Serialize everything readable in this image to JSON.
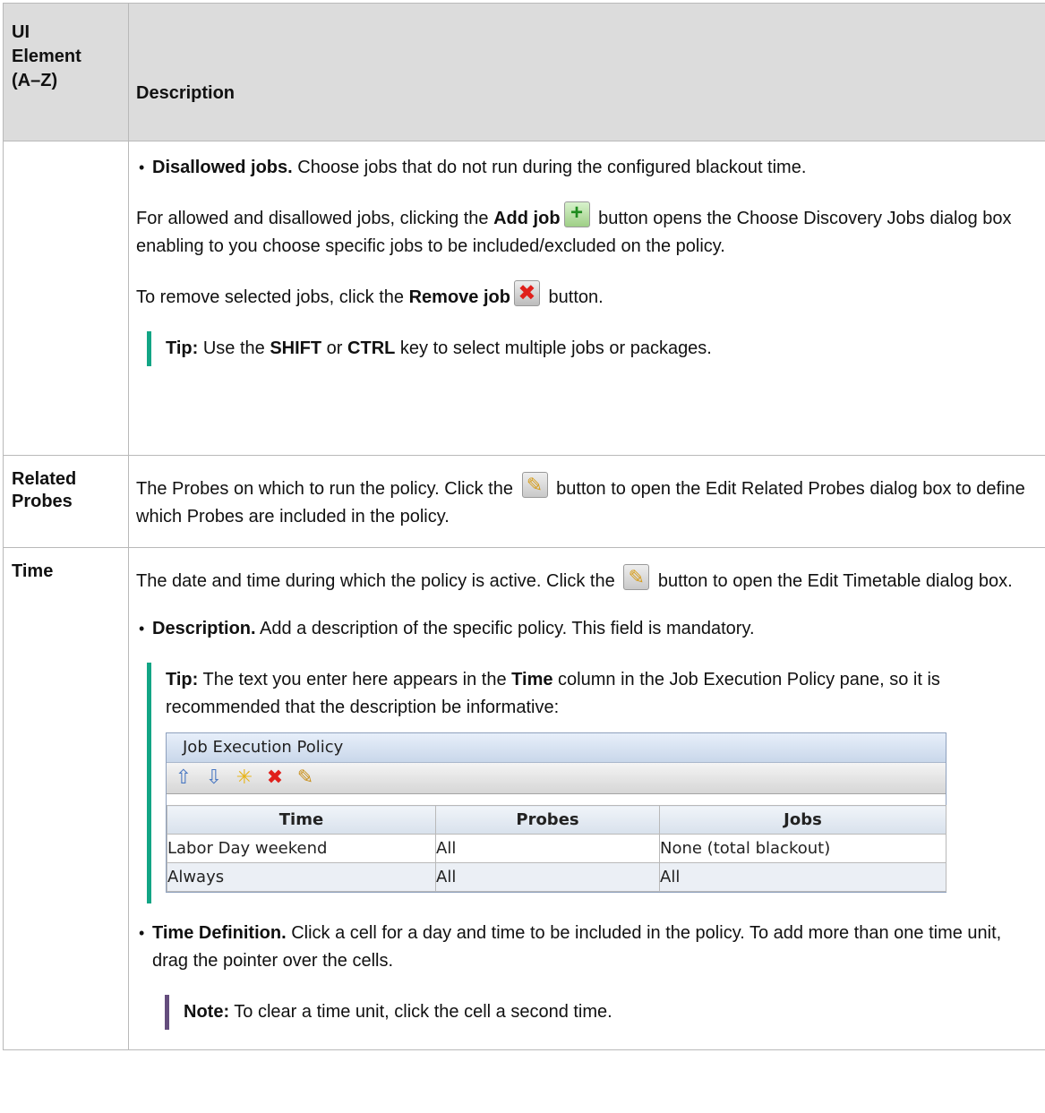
{
  "header": {
    "col1": [
      "UI",
      "Element",
      "(A–Z)"
    ],
    "col2": "Description"
  },
  "row1": {
    "bullet_bold": "Disallowed jobs.",
    "bullet_text": " Choose jobs that do not run during the configured blackout time.",
    "p1_pre": "For allowed and disallowed jobs, clicking the ",
    "p1_bold": "Add job",
    "p1_post": " button opens the Choose Discovery Jobs dialog box enabling to you choose specific jobs to be included/excluded on the policy.",
    "p2_pre": "To remove selected jobs, click the ",
    "p2_bold": "Remove job",
    "p2_post": " button.",
    "tip_label": "Tip:",
    "tip_pre": " Use the ",
    "tip_shift": "SHIFT",
    "tip_or": " or ",
    "tip_ctrl": "CTRL",
    "tip_post": " key to select multiple jobs or packages."
  },
  "row2": {
    "element": [
      "Related",
      "Probes"
    ],
    "text_pre": "The Probes on which to run the policy. Click the ",
    "text_post": " button to open the Edit Related Probes dialog box to define which Probes are included in the policy."
  },
  "row3": {
    "element": "Time",
    "text_pre": "The date and time during which the policy is active. Click the ",
    "text_post": " button to open the Edit Timetable dialog box.",
    "b1_bold": "Description.",
    "b1_text": " Add a description of the specific policy. This field is mandatory.",
    "tip_label": "Tip:",
    "tip_pre": " The text you enter here appears in the ",
    "tip_bold": "Time",
    "tip_post": " column in the Job Execution Policy pane, so it is recommended that the description be informative:",
    "b2_bold": "Time Definition.",
    "b2_text": " Click a cell for a day and time to be included in the policy. To add more than one time unit, drag the pointer over the cells.",
    "note_label": "Note:",
    "note_text": " To clear a time unit, click the cell a second time."
  },
  "screenshot": {
    "title": "Job Execution Policy",
    "columns": [
      "Time",
      "Probes",
      "Jobs"
    ],
    "rows": [
      [
        "Labor Day weekend",
        "All",
        "None (total blackout)"
      ],
      [
        "Always",
        "All",
        "All"
      ]
    ]
  }
}
